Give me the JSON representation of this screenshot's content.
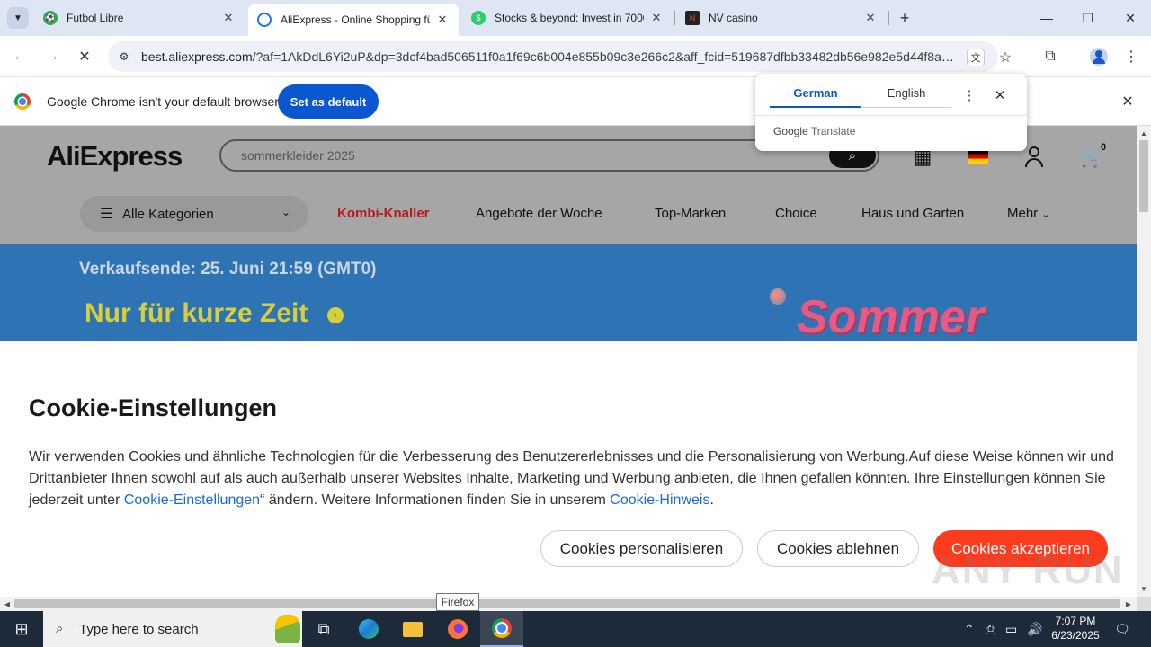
{
  "browser": {
    "tabs": [
      {
        "title": "Futbol Libre",
        "icon": "soccer-ball-icon",
        "color": "#34a853"
      },
      {
        "title": "AliExpress - Online Shopping fü",
        "icon": "aliexpress-tab-icon",
        "color": "#1a73e8"
      },
      {
        "title": "Stocks & beyond: Invest in 7000",
        "icon": "stocks-tab-icon",
        "color": "#2ecc71"
      },
      {
        "title": "NV casino",
        "icon": "casino-tab-icon",
        "color": "#c0392b"
      }
    ],
    "url_host": "best.aliexpress.com",
    "url_rest": "/?af=1AkDdL6Yi2uP&dp=3dcf4bad506511f0a1f69c6b004e855b09c3e266c2&aff_fcid=519687dfbb33482db56e982e5d44f8aa-...",
    "infobar_text": "Google Chrome isn't your default browser",
    "infobar_button": "Set as default"
  },
  "translate": {
    "lang_source": "German",
    "lang_target": "English",
    "brand": "Google",
    "brand_suffix": "Translate"
  },
  "aliexpress": {
    "logo": "AliExpress",
    "search_placeholder": "sommerkleider 2025",
    "cart_count": "0",
    "categories_label": "Alle Kategorien",
    "nav": [
      "Kombi-Knaller",
      "Angebote der Woche",
      "Top-Marken",
      "Choice",
      "Haus und Garten",
      "Mehr"
    ],
    "banner_sale": "Verkaufsende: 25. Juni 21:59 (GMT0)",
    "banner_short": "Nur für kurze Zeit",
    "banner_sommer": "Sommer"
  },
  "cookie": {
    "title": "Cookie-Einstellungen",
    "text_1": "Wir verwenden Cookies und ähnliche Technologien für die Verbesserung des Benutzererlebnisses und die Personalisierung von Werbung.Auf diese Weise können wir und Drittanbieter Ihnen sowohl auf als auch außerhalb unserer Websites Inhalte, Marketing und Werbung anbieten, die Ihnen gefallen könnten. Ihre Einstellungen können Sie jederzeit unter ",
    "link_1": "Cookie-Einstellungen",
    "text_2": "“ ändern. Weitere Informationen finden Sie in unserem ",
    "link_2": "Cookie-Hinweis",
    "text_3": ".",
    "btn_personalize": "Cookies personalisieren",
    "btn_reject": "Cookies ablehnen",
    "btn_accept": "Cookies akzeptieren"
  },
  "tooltip": "Firefox",
  "watermark": "ANY RUN",
  "taskbar": {
    "search_placeholder": "Type here to search",
    "time": "7:07 PM",
    "date": "6/23/2025"
  },
  "colors": {
    "accent_blue": "#0b57d0",
    "ae_red": "#fd3b1f",
    "banner_blue": "#2e74b5"
  }
}
